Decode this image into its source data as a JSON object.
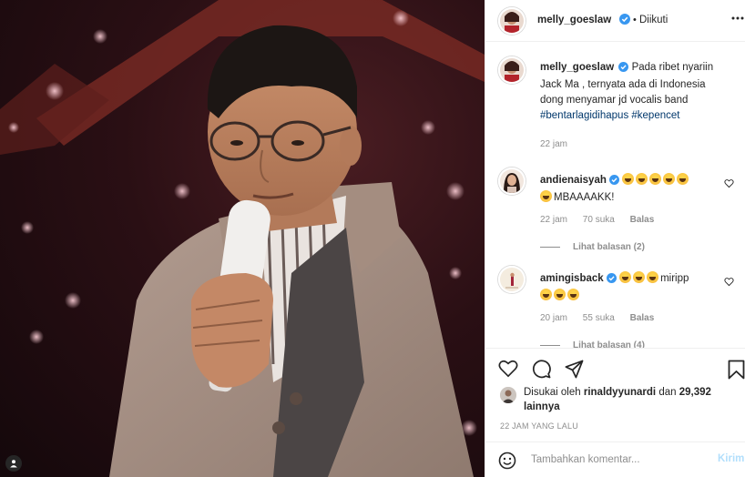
{
  "post": {
    "author": "melly_goeslaw",
    "follow_separator": "•",
    "follow_status": "Diikuti",
    "caption_text": "Pada ribet nyariin Jack Ma , ternyata ada di Indonesia dong menyamar jd vocalis band",
    "hashtags": "#bentarlagidihapus #kepencet",
    "caption_time": "22 jam"
  },
  "comments": [
    {
      "username": "andienaisyah",
      "text": "MBAAAAKK!",
      "emoji_count_line1": 5,
      "emoji_count_line2": 1,
      "time": "22 jam",
      "likes": "70 suka",
      "reply": "Balas",
      "view_replies": "Lihat balasan (2)"
    },
    {
      "username": "amingisback",
      "text": "miripp",
      "emoji_count_line1": 3,
      "emoji_count_line2": 3,
      "time": "20 jam",
      "likes": "55 suka",
      "reply": "Balas",
      "view_replies": "Lihat balasan (4)"
    }
  ],
  "likes": {
    "prefix": "Disukai oleh",
    "liker": "rinaldyyunardi",
    "connector": "dan",
    "others": "29,392 lainnya"
  },
  "timestamp": "22 JAM YANG LALU",
  "composer": {
    "placeholder": "Tambahkan komentar...",
    "send_label": "Kirim"
  },
  "icons": {
    "verified": "verified-badge-icon",
    "more": "more-options-icon",
    "heart": "heart-icon",
    "comment": "comment-icon",
    "share": "share-icon",
    "save": "bookmark-icon",
    "emoji": "emoji-smile-icon"
  },
  "colors": {
    "verified_blue": "#3897f0",
    "link": "#00376b",
    "muted": "#8e8e8e",
    "send_disabled": "#b2dffc"
  }
}
